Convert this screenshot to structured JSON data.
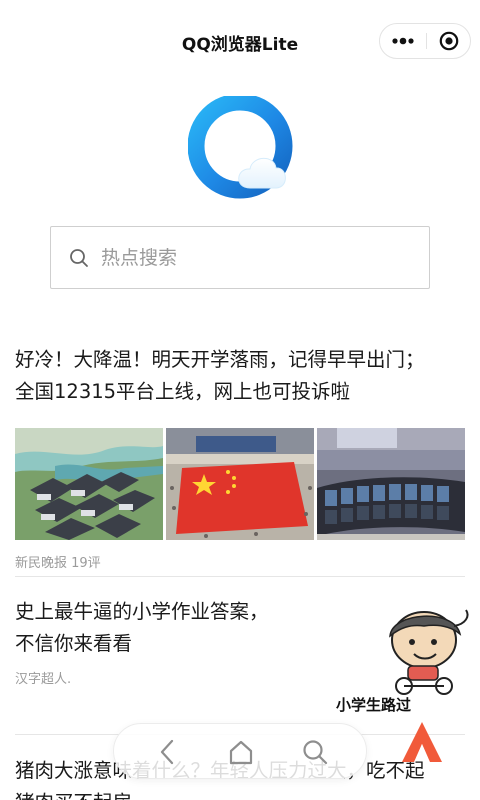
{
  "app": {
    "title": "QQ浏览器Lite"
  },
  "icons": {
    "more": "more-dots-icon",
    "close": "miniprogram-close-icon",
    "logo": "qq-browser-logo",
    "search": "search-icon",
    "back": "back-arrow-icon",
    "home": "home-icon",
    "nav_search": "search-icon"
  },
  "colors": {
    "brand_blue": "#1e9bf0",
    "text": "#1a1a1a",
    "meta": "#9b9b9b",
    "promo": "#f15a3a"
  },
  "search": {
    "placeholder": "热点搜索"
  },
  "articles": [
    {
      "title_line1": "好冷！大降温！明天开学落雨，记得早早出门；",
      "title_line2": "全国12315平台上线，网上也可投诉啦",
      "source": "新民晚报 19评"
    },
    {
      "title_line1": "史上最牛逼的小学作业答案，",
      "title_line2": "不信你来看看",
      "source": "汉字超人."
    },
    {
      "title_line1": "猪肉大涨意味着什么？年轻人压力过大，吃不起",
      "title_line2": "猪肉买不起房"
    }
  ],
  "sticker": {
    "caption": "小学生路过"
  }
}
